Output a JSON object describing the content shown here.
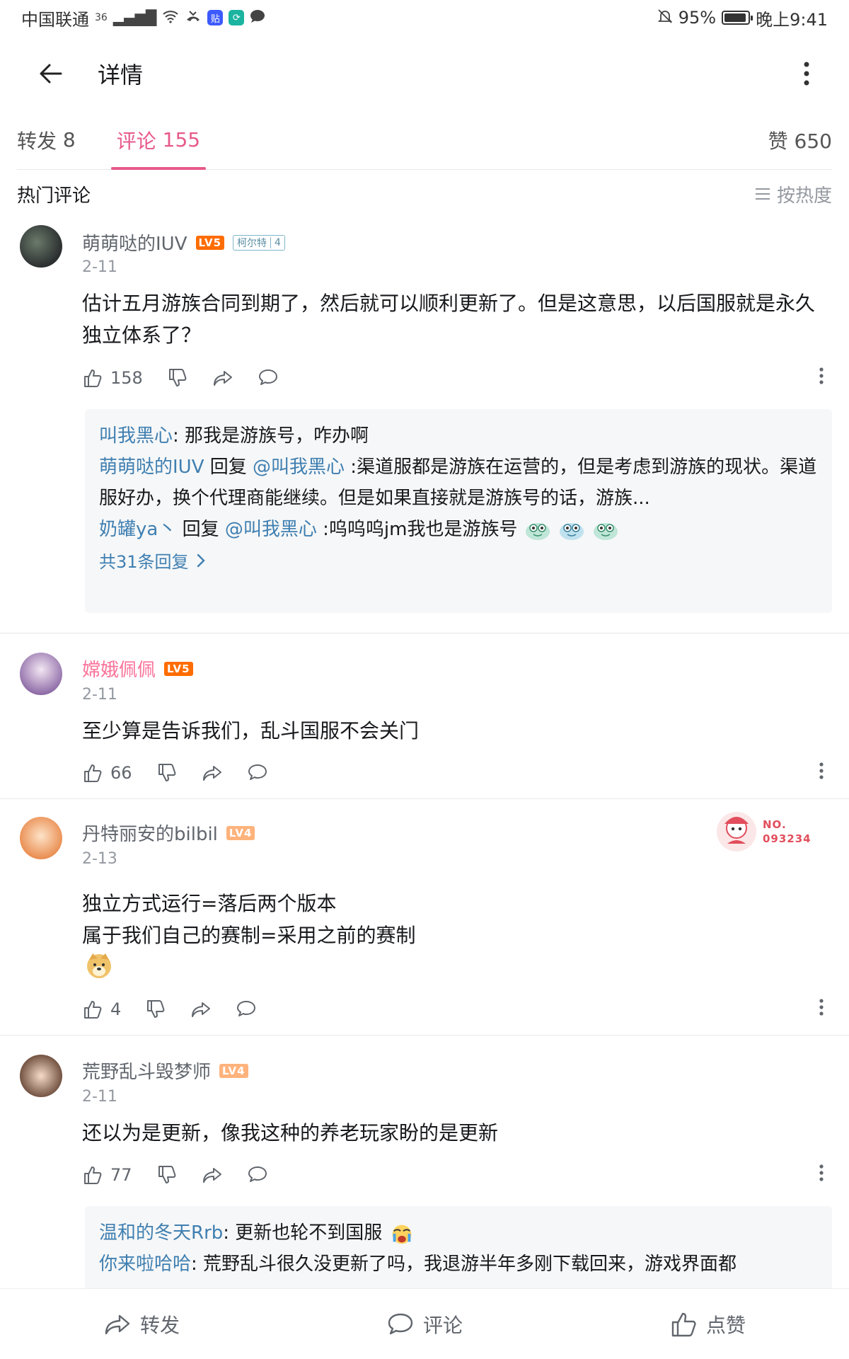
{
  "status": {
    "carrier": "中国联通",
    "signal": "36",
    "battery": "95%",
    "time": "晚上9:41"
  },
  "header": {
    "title": "详情"
  },
  "tabs": [
    {
      "label": "转发",
      "count": "8"
    },
    {
      "label": "评论",
      "count": "155"
    }
  ],
  "likes_tab": {
    "label": "赞",
    "count": "650"
  },
  "hot": {
    "title": "热门评论",
    "sort": "按热度"
  },
  "comments": [
    {
      "name": "萌萌哒的IUV",
      "level": "LV5",
      "medal": {
        "name": "柯尔特",
        "level": "4"
      },
      "date": "2-11",
      "text": "估计五月游族合同到期了，然后就可以顺利更新了。但是这意思，以后国服就是永久独立体系了？",
      "likes": "158",
      "replies": [
        {
          "user": "叫我黑心",
          "text": ": 那我是游族号，咋办啊"
        },
        {
          "user": "萌萌哒的IUV",
          "mid": " 回复 ",
          "at": "@叫我黑心",
          "text": " :渠道服都是游族在运营的，但是考虑到游族的现状。渠道服好办，换个代理商能继续。但是如果直接就是游族号的话，游族..."
        },
        {
          "user": "奶罐ya丶",
          "mid": " 回复 ",
          "at": "@叫我黑心",
          "text": " :呜呜呜jm我也是游族号"
        }
      ],
      "reply_total": "共31条回复"
    },
    {
      "name": "嫦娥佩佩",
      "level": "LV5",
      "date": "2-11",
      "text": "至少算是告诉我们，乱斗国服不会关门",
      "likes": "66"
    },
    {
      "name": "丹特丽安的bilbil",
      "level": "LV4",
      "date": "2-13",
      "badge": {
        "no": "NO.",
        "num": "093234"
      },
      "text": "独立方式运行=落后两个版本\n属于我们自己的赛制=采用之前的赛制",
      "likes": "4"
    },
    {
      "name": "荒野乱斗毁梦师",
      "level": "LV4",
      "date": "2-11",
      "text": "还以为是更新，像我这种的养老玩家盼的是更新",
      "likes": "77",
      "replies": [
        {
          "user": "温和的冬天Rrb",
          "text": ": 更新也轮不到国服"
        },
        {
          "user": "你来啦哈哈",
          "text": ": 荒野乱斗很久没更新了吗，我退游半年多刚下载回来，游戏界面都"
        }
      ]
    }
  ],
  "bottom": {
    "repost": "转发",
    "comment": "评论",
    "like": "点赞"
  },
  "colors": {
    "accent": "#e7598b",
    "link": "#3f7fb1",
    "level5": "#ff6c00",
    "level4": "#ffb37c"
  }
}
